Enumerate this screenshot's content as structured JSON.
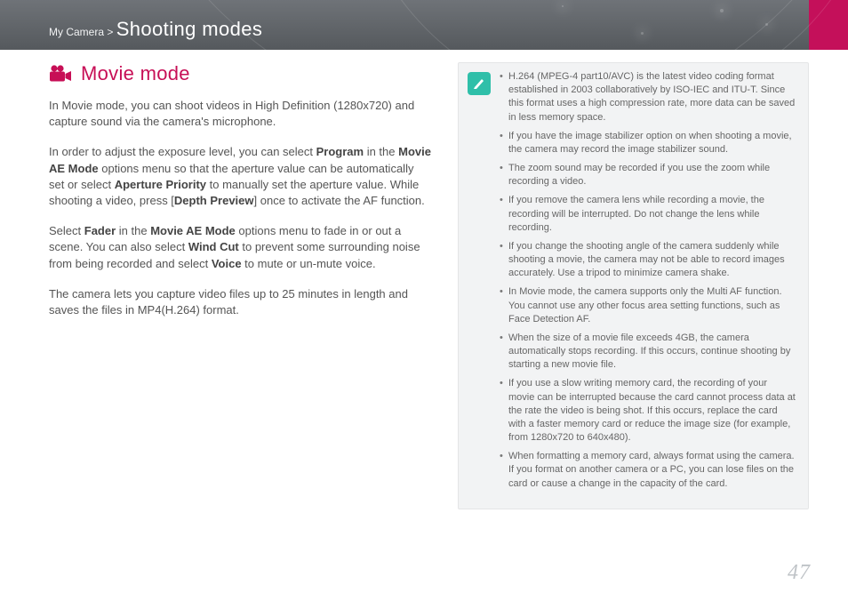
{
  "breadcrumb": {
    "path": "My Camera >",
    "section": "Shooting modes"
  },
  "heading": "Movie mode",
  "paragraphs": {
    "p1_a": "In Movie mode, you can shoot videos in High Definition (1280x720) and capture sound via the camera's microphone.",
    "p2_a": "In order to adjust the exposure level, you can select ",
    "p2_b1": "Program",
    "p2_c": " in the ",
    "p2_b2": "Movie AE Mode",
    "p2_d": " options menu so that the aperture value can be automatically set or select ",
    "p2_b3": "Aperture Priority",
    "p2_e": " to manually set the aperture value. While shooting a video, press [",
    "p2_b4": "Depth Preview",
    "p2_f": "] once to activate the AF function.",
    "p3_a": "Select ",
    "p3_b1": "Fader",
    "p3_c": " in the ",
    "p3_b2": "Movie AE Mode",
    "p3_d": " options menu to fade in or out a scene. You can also select ",
    "p3_b3": "Wind Cut",
    "p3_e": " to prevent some surrounding noise from being recorded and select ",
    "p3_b4": "Voice",
    "p3_f": " to mute or un-mute voice.",
    "p4_a": "The camera lets you capture video files up to 25 minutes in length and saves the files in MP4(H.264) format."
  },
  "notes": [
    "H.264 (MPEG-4 part10/AVC) is the latest video coding format established in 2003 collaboratively by ISO-IEC and ITU-T. Since this format uses a high compression rate, more data can be saved in less memory space.",
    "If you have the image stabilizer option on when shooting a movie, the camera may record the image stabilizer sound.",
    "The zoom sound may be recorded if you use the zoom while recording a video.",
    "If you remove the camera lens while recording a movie, the recording will be interrupted. Do not change the lens while recording.",
    "If you change the shooting angle of the camera suddenly while shooting a movie, the camera may not be able to record images accurately. Use a tripod to minimize camera shake.",
    "In Movie mode, the camera supports only the Multi AF function. You cannot use any other focus area setting functions, such as Face Detection AF.",
    "When the size of a movie file exceeds 4GB, the camera automatically stops recording. If this occurs, continue shooting by starting a new movie file.",
    "If you use a slow writing memory card, the recording of your movie can be interrupted because the card cannot process data at the rate the video is being shot. If this occurs, replace the card with a faster memory card or reduce the image size (for example, from 1280x720 to 640x480).",
    "When formatting a memory card, always format using the camera. If you format on another camera or a PC, you can lose files on the card or cause a change in the capacity of the card."
  ],
  "page_number": "47"
}
